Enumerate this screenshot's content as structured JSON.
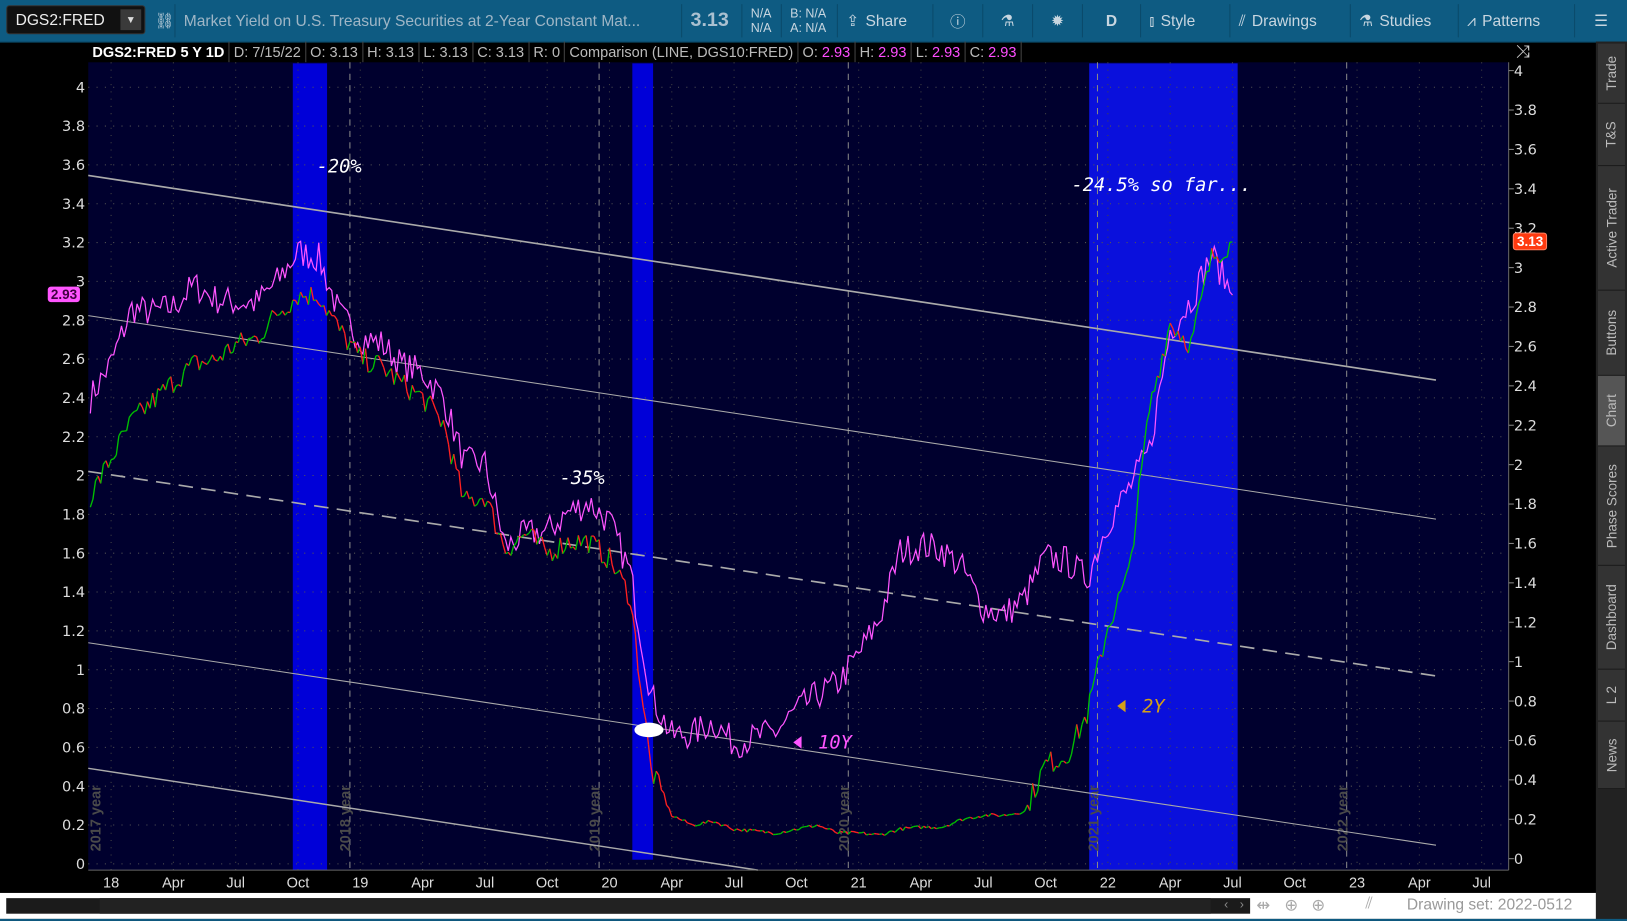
{
  "toolbar": {
    "symbol": "DGS2:FRED",
    "description": "Market Yield on U.S. Treasury Securities at 2-Year Constant Mat...",
    "last": "3.13",
    "na1": "N/A",
    "na2": "N/A",
    "bid": "B: N/A",
    "ask": "A: N/A",
    "share": "Share",
    "period": "D",
    "style": "Style",
    "drawings": "Drawings",
    "studies": "Studies",
    "patterns": "Patterns"
  },
  "info": {
    "title": "DGS2:FRED 5 Y 1D",
    "date": "D: 7/15/22",
    "open": "O: 3.13",
    "high": "H: 3.13",
    "low": "L: 3.13",
    "close": "C: 3.13",
    "range": "R: 0",
    "comparison": "Comparison (LINE, DGS10:FRED)",
    "c_open_l": "O:",
    "c_open": "2.93",
    "c_high_l": "H:",
    "c_high": "2.93",
    "c_low_l": "L:",
    "c_low": "2.93",
    "c_close_l": "C:",
    "c_close": "2.93"
  },
  "sidebar": [
    "Trade",
    "T&S",
    "Active Trader",
    "Buttons",
    "Chart",
    "Phase Scores",
    "Dashboard",
    "L 2",
    "News"
  ],
  "bottom": {
    "drawing_set": "Drawing set: 2022-0512"
  },
  "colors": {
    "up": "#00c000",
    "down": "#ff2020",
    "comparison": "#ff55ff",
    "band": "#0000d8",
    "bg": "#00002e"
  },
  "chart_data": {
    "type": "line",
    "title": "DGS2:FRED 5 Y 1D",
    "x": [
      "Dec 17",
      "Jan 18",
      "Feb 18",
      "Mar 18",
      "Apr 18",
      "May 18",
      "Jun 18",
      "Jul 18",
      "Aug 18",
      "Sep 18",
      "Oct 18",
      "Nov 18",
      "Dec 18",
      "Jan 19",
      "Feb 19",
      "Mar 19",
      "Apr 19",
      "May 19",
      "Jun 19",
      "Jul 19",
      "Aug 19",
      "Sep 19",
      "Oct 19",
      "Nov 19",
      "Dec 19",
      "Jan 20",
      "Feb 20",
      "Mar 20",
      "Apr 20",
      "May 20",
      "Jun 20",
      "Jul 20",
      "Aug 20",
      "Sep 20",
      "Oct 20",
      "Nov 20",
      "Dec 20",
      "Jan 21",
      "Feb 21",
      "Mar 21",
      "Apr 21",
      "May 21",
      "Jun 21",
      "Jul 21",
      "Aug 21",
      "Sep 21",
      "Oct 21",
      "Nov 21",
      "Dec 21",
      "Jan 22",
      "Feb 22",
      "Mar 22",
      "Apr 22",
      "May 22",
      "Jun 22",
      "Jul 22"
    ],
    "series": [
      {
        "name": "2Y (DGS2)",
        "axis": "right",
        "values": [
          1.84,
          2.03,
          2.22,
          2.32,
          2.42,
          2.51,
          2.53,
          2.61,
          2.64,
          2.77,
          2.86,
          2.86,
          2.68,
          2.54,
          2.5,
          2.41,
          2.34,
          2.21,
          1.81,
          1.84,
          1.57,
          1.65,
          1.55,
          1.61,
          1.61,
          1.52,
          1.33,
          0.45,
          0.22,
          0.17,
          0.19,
          0.15,
          0.14,
          0.13,
          0.15,
          0.17,
          0.13,
          0.13,
          0.12,
          0.15,
          0.16,
          0.16,
          0.2,
          0.22,
          0.22,
          0.24,
          0.48,
          0.52,
          0.73,
          1.18,
          1.44,
          2.28,
          2.72,
          2.61,
          3.05,
          3.13
        ]
      },
      {
        "name": "10Y (DGS10)",
        "axis": "left",
        "values": [
          2.4,
          2.58,
          2.86,
          2.84,
          2.87,
          2.98,
          2.91,
          2.89,
          2.89,
          3.0,
          3.15,
          3.12,
          2.83,
          2.71,
          2.68,
          2.57,
          2.53,
          2.4,
          2.07,
          2.06,
          1.63,
          1.7,
          1.71,
          1.81,
          1.86,
          1.76,
          1.5,
          0.87,
          0.66,
          0.67,
          0.73,
          0.62,
          0.65,
          0.68,
          0.79,
          0.87,
          0.93,
          1.08,
          1.26,
          1.61,
          1.64,
          1.62,
          1.52,
          1.32,
          1.28,
          1.37,
          1.58,
          1.56,
          1.47,
          1.76,
          1.93,
          2.13,
          2.75,
          2.9,
          3.14,
          2.93
        ]
      }
    ],
    "left_axis": {
      "ticks": [
        "0",
        "0.2",
        "0.4",
        "0.6",
        "0.8",
        "1",
        "1.2",
        "1.4",
        "1.6",
        "1.8",
        "2",
        "2.2",
        "2.4",
        "2.6",
        "2.8",
        "3",
        "3.2",
        "3.4",
        "3.6",
        "3.8",
        "4"
      ],
      "range": [
        0,
        4
      ]
    },
    "right_axis": {
      "ticks": [
        "0",
        "0.2",
        "0.4",
        "0.6",
        "0.8",
        "1",
        "1.2",
        "1.4",
        "1.6",
        "1.8",
        "2",
        "2.2",
        "2.4",
        "2.6",
        "2.8",
        "3",
        "3.2",
        "3.4",
        "3.6",
        "3.8",
        "4"
      ],
      "range": [
        0,
        4
      ]
    },
    "x_ticks": [
      "18",
      "Apr",
      "Jul",
      "Oct",
      "19",
      "Apr",
      "Jul",
      "Oct",
      "20",
      "Apr",
      "Jul",
      "Oct",
      "21",
      "Apr",
      "Jul",
      "Oct",
      "22",
      "Apr",
      "Jul",
      "Oct",
      "23",
      "Apr",
      "Jul"
    ],
    "year_labels": [
      "2017 year",
      "2018 year",
      "2019 year",
      "2020 year",
      "2021 year",
      "2022 year"
    ],
    "shaded_periods": [
      {
        "from": "Sep 18",
        "to": "Nov 18"
      },
      {
        "from": "Feb 20",
        "to": "Mar 20"
      },
      {
        "from": "Dec 21",
        "to": "Jul 22"
      }
    ],
    "annotations": [
      "-20%",
      "-35%",
      "-24.5% so far...",
      "10Y",
      "2Y"
    ],
    "last_left": "2.93",
    "last_right": "3.13"
  }
}
